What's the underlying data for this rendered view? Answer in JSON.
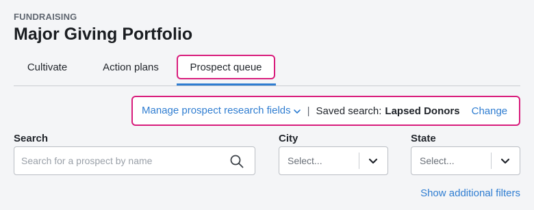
{
  "header": {
    "eyebrow": "FUNDRAISING",
    "title": "Major Giving Portfolio"
  },
  "tabs": [
    {
      "label": "Cultivate",
      "active": false
    },
    {
      "label": "Action plans",
      "active": false
    },
    {
      "label": "Prospect queue",
      "active": true
    }
  ],
  "saved_bar": {
    "manage_link": "Manage prospect research fields",
    "separator": "|",
    "saved_label": "Saved search:",
    "saved_value": "Lapsed Donors",
    "change_link": "Change"
  },
  "filters": {
    "search": {
      "label": "Search",
      "placeholder": "Search for a prospect by name",
      "value": ""
    },
    "city": {
      "label": "City",
      "value": "Select..."
    },
    "state": {
      "label": "State",
      "value": "Select..."
    },
    "more_link": "Show additional filters"
  },
  "colors": {
    "accent": "#2f7dd1",
    "highlight": "#d81b7b",
    "background": "#f4f5f7"
  },
  "icons": {
    "search": "search-icon",
    "chevron": "chevron-down-icon"
  }
}
